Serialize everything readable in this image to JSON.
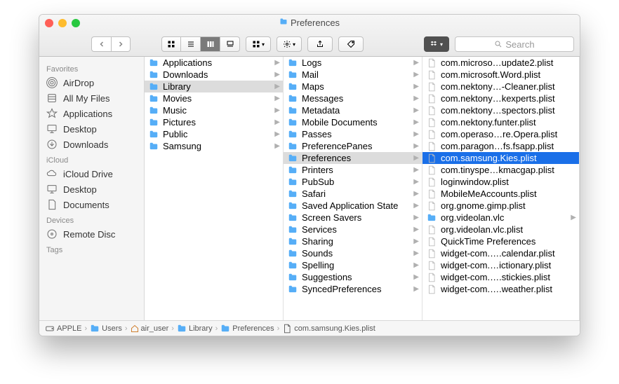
{
  "window_title": "Preferences",
  "search_placeholder": "Search",
  "sidebar": {
    "sections": [
      {
        "header": "Favorites",
        "items": [
          "AirDrop",
          "All My Files",
          "Applications",
          "Desktop",
          "Downloads"
        ]
      },
      {
        "header": "iCloud",
        "items": [
          "iCloud Drive",
          "Desktop",
          "Documents"
        ]
      },
      {
        "header": "Devices",
        "items": [
          "Remote Disc"
        ]
      },
      {
        "header": "Tags",
        "items": []
      }
    ]
  },
  "col1": [
    {
      "n": "Applications",
      "t": "folder",
      "chv": true
    },
    {
      "n": "Downloads",
      "t": "folder",
      "chv": true
    },
    {
      "n": "Library",
      "t": "folder",
      "chv": true,
      "sel": true
    },
    {
      "n": "Movies",
      "t": "folder",
      "chv": true
    },
    {
      "n": "Music",
      "t": "folder",
      "chv": true
    },
    {
      "n": "Pictures",
      "t": "folder",
      "chv": true
    },
    {
      "n": "Public",
      "t": "folder",
      "chv": true
    },
    {
      "n": "Samsung",
      "t": "folder",
      "chv": true
    }
  ],
  "col2": [
    {
      "n": "Logs",
      "t": "folder",
      "chv": true
    },
    {
      "n": "Mail",
      "t": "folder",
      "chv": true
    },
    {
      "n": "Maps",
      "t": "folder",
      "chv": true
    },
    {
      "n": "Messages",
      "t": "folder",
      "chv": true
    },
    {
      "n": "Metadata",
      "t": "folder",
      "chv": true
    },
    {
      "n": "Mobile Documents",
      "t": "folder",
      "chv": true
    },
    {
      "n": "Passes",
      "t": "folder",
      "chv": true
    },
    {
      "n": "PreferencePanes",
      "t": "folder",
      "chv": true
    },
    {
      "n": "Preferences",
      "t": "folder",
      "chv": true,
      "sel": true
    },
    {
      "n": "Printers",
      "t": "folder",
      "chv": true
    },
    {
      "n": "PubSub",
      "t": "folder",
      "chv": true
    },
    {
      "n": "Safari",
      "t": "folder",
      "chv": true
    },
    {
      "n": "Saved Application State",
      "t": "folder",
      "chv": true
    },
    {
      "n": "Screen Savers",
      "t": "folder",
      "chv": true
    },
    {
      "n": "Services",
      "t": "folder",
      "chv": true
    },
    {
      "n": "Sharing",
      "t": "folder",
      "chv": true
    },
    {
      "n": "Sounds",
      "t": "folder",
      "chv": true
    },
    {
      "n": "Spelling",
      "t": "folder",
      "chv": true
    },
    {
      "n": "Suggestions",
      "t": "folder",
      "chv": true
    },
    {
      "n": "SyncedPreferences",
      "t": "folder",
      "chv": true
    }
  ],
  "col3": [
    {
      "n": "com.microso…update2.plist",
      "t": "file"
    },
    {
      "n": "com.microsoft.Word.plist",
      "t": "file"
    },
    {
      "n": "com.nektony…-Cleaner.plist",
      "t": "file"
    },
    {
      "n": "com.nektony…kexperts.plist",
      "t": "file"
    },
    {
      "n": "com.nektony…spectors.plist",
      "t": "file"
    },
    {
      "n": "com.nektony.funter.plist",
      "t": "file"
    },
    {
      "n": "com.operaso…re.Opera.plist",
      "t": "file"
    },
    {
      "n": "com.paragon…fs.fsapp.plist",
      "t": "file"
    },
    {
      "n": "com.samsung.Kies.plist",
      "t": "file",
      "selblue": true
    },
    {
      "n": "com.tinyspe…kmacgap.plist",
      "t": "file"
    },
    {
      "n": "loginwindow.plist",
      "t": "file"
    },
    {
      "n": "MobileMeAccounts.plist",
      "t": "file"
    },
    {
      "n": "org.gnome.gimp.plist",
      "t": "file"
    },
    {
      "n": "org.videolan.vlc",
      "t": "folder",
      "chv": true
    },
    {
      "n": "org.videolan.vlc.plist",
      "t": "file"
    },
    {
      "n": "QuickTime Preferences",
      "t": "file"
    },
    {
      "n": "widget-com.….calendar.plist",
      "t": "file"
    },
    {
      "n": "widget-com.…ictionary.plist",
      "t": "file"
    },
    {
      "n": "widget-com.….stickies.plist",
      "t": "file"
    },
    {
      "n": "widget-com.….weather.plist",
      "t": "file"
    }
  ],
  "pathbar": [
    "APPLE",
    "Users",
    "air_user",
    "Library",
    "Preferences",
    "com.samsung.Kies.plist"
  ]
}
